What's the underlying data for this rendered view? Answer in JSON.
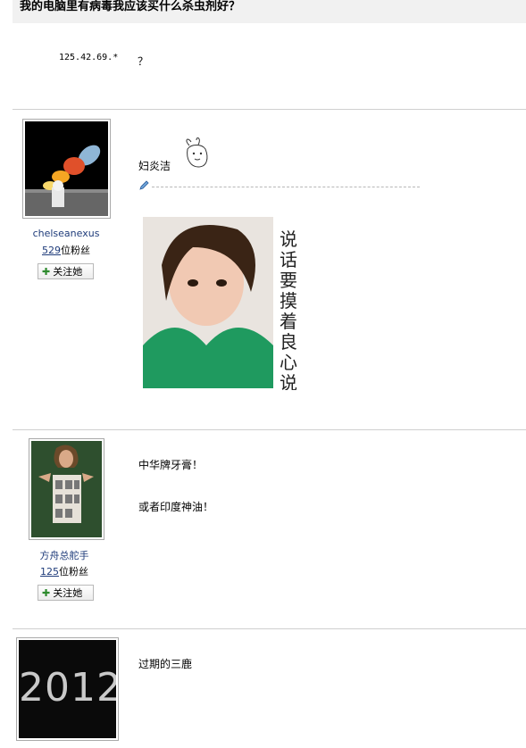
{
  "question": {
    "title": "我的电脑里有病毒我应该买什么杀虫剂好？",
    "ip": "125.42.69.*",
    "text": "？"
  },
  "answers": [
    {
      "user": {
        "name": "chelseanexus",
        "fans_count": "529",
        "fans_suffix": "位粉丝",
        "follow_label": "关注她"
      },
      "lines": [
        "妇炎洁"
      ],
      "meme_text": [
        "说",
        "话",
        "要",
        "摸",
        "着",
        "良",
        "心",
        "说"
      ]
    },
    {
      "user": {
        "name": "方舟总舵手",
        "fans_count": "125",
        "fans_suffix": "位粉丝",
        "follow_label": "关注她"
      },
      "lines": [
        "中华牌牙膏！",
        "或者印度神油！"
      ]
    },
    {
      "user": {},
      "lines": [
        "过期的三鹿"
      ],
      "poster_text": "2012"
    }
  ],
  "colors": {
    "title_bg": "#f1f1f1",
    "link": "#1e3b7a",
    "separator": "#cfcfcf",
    "follow_plus": "#2d8a2d"
  }
}
